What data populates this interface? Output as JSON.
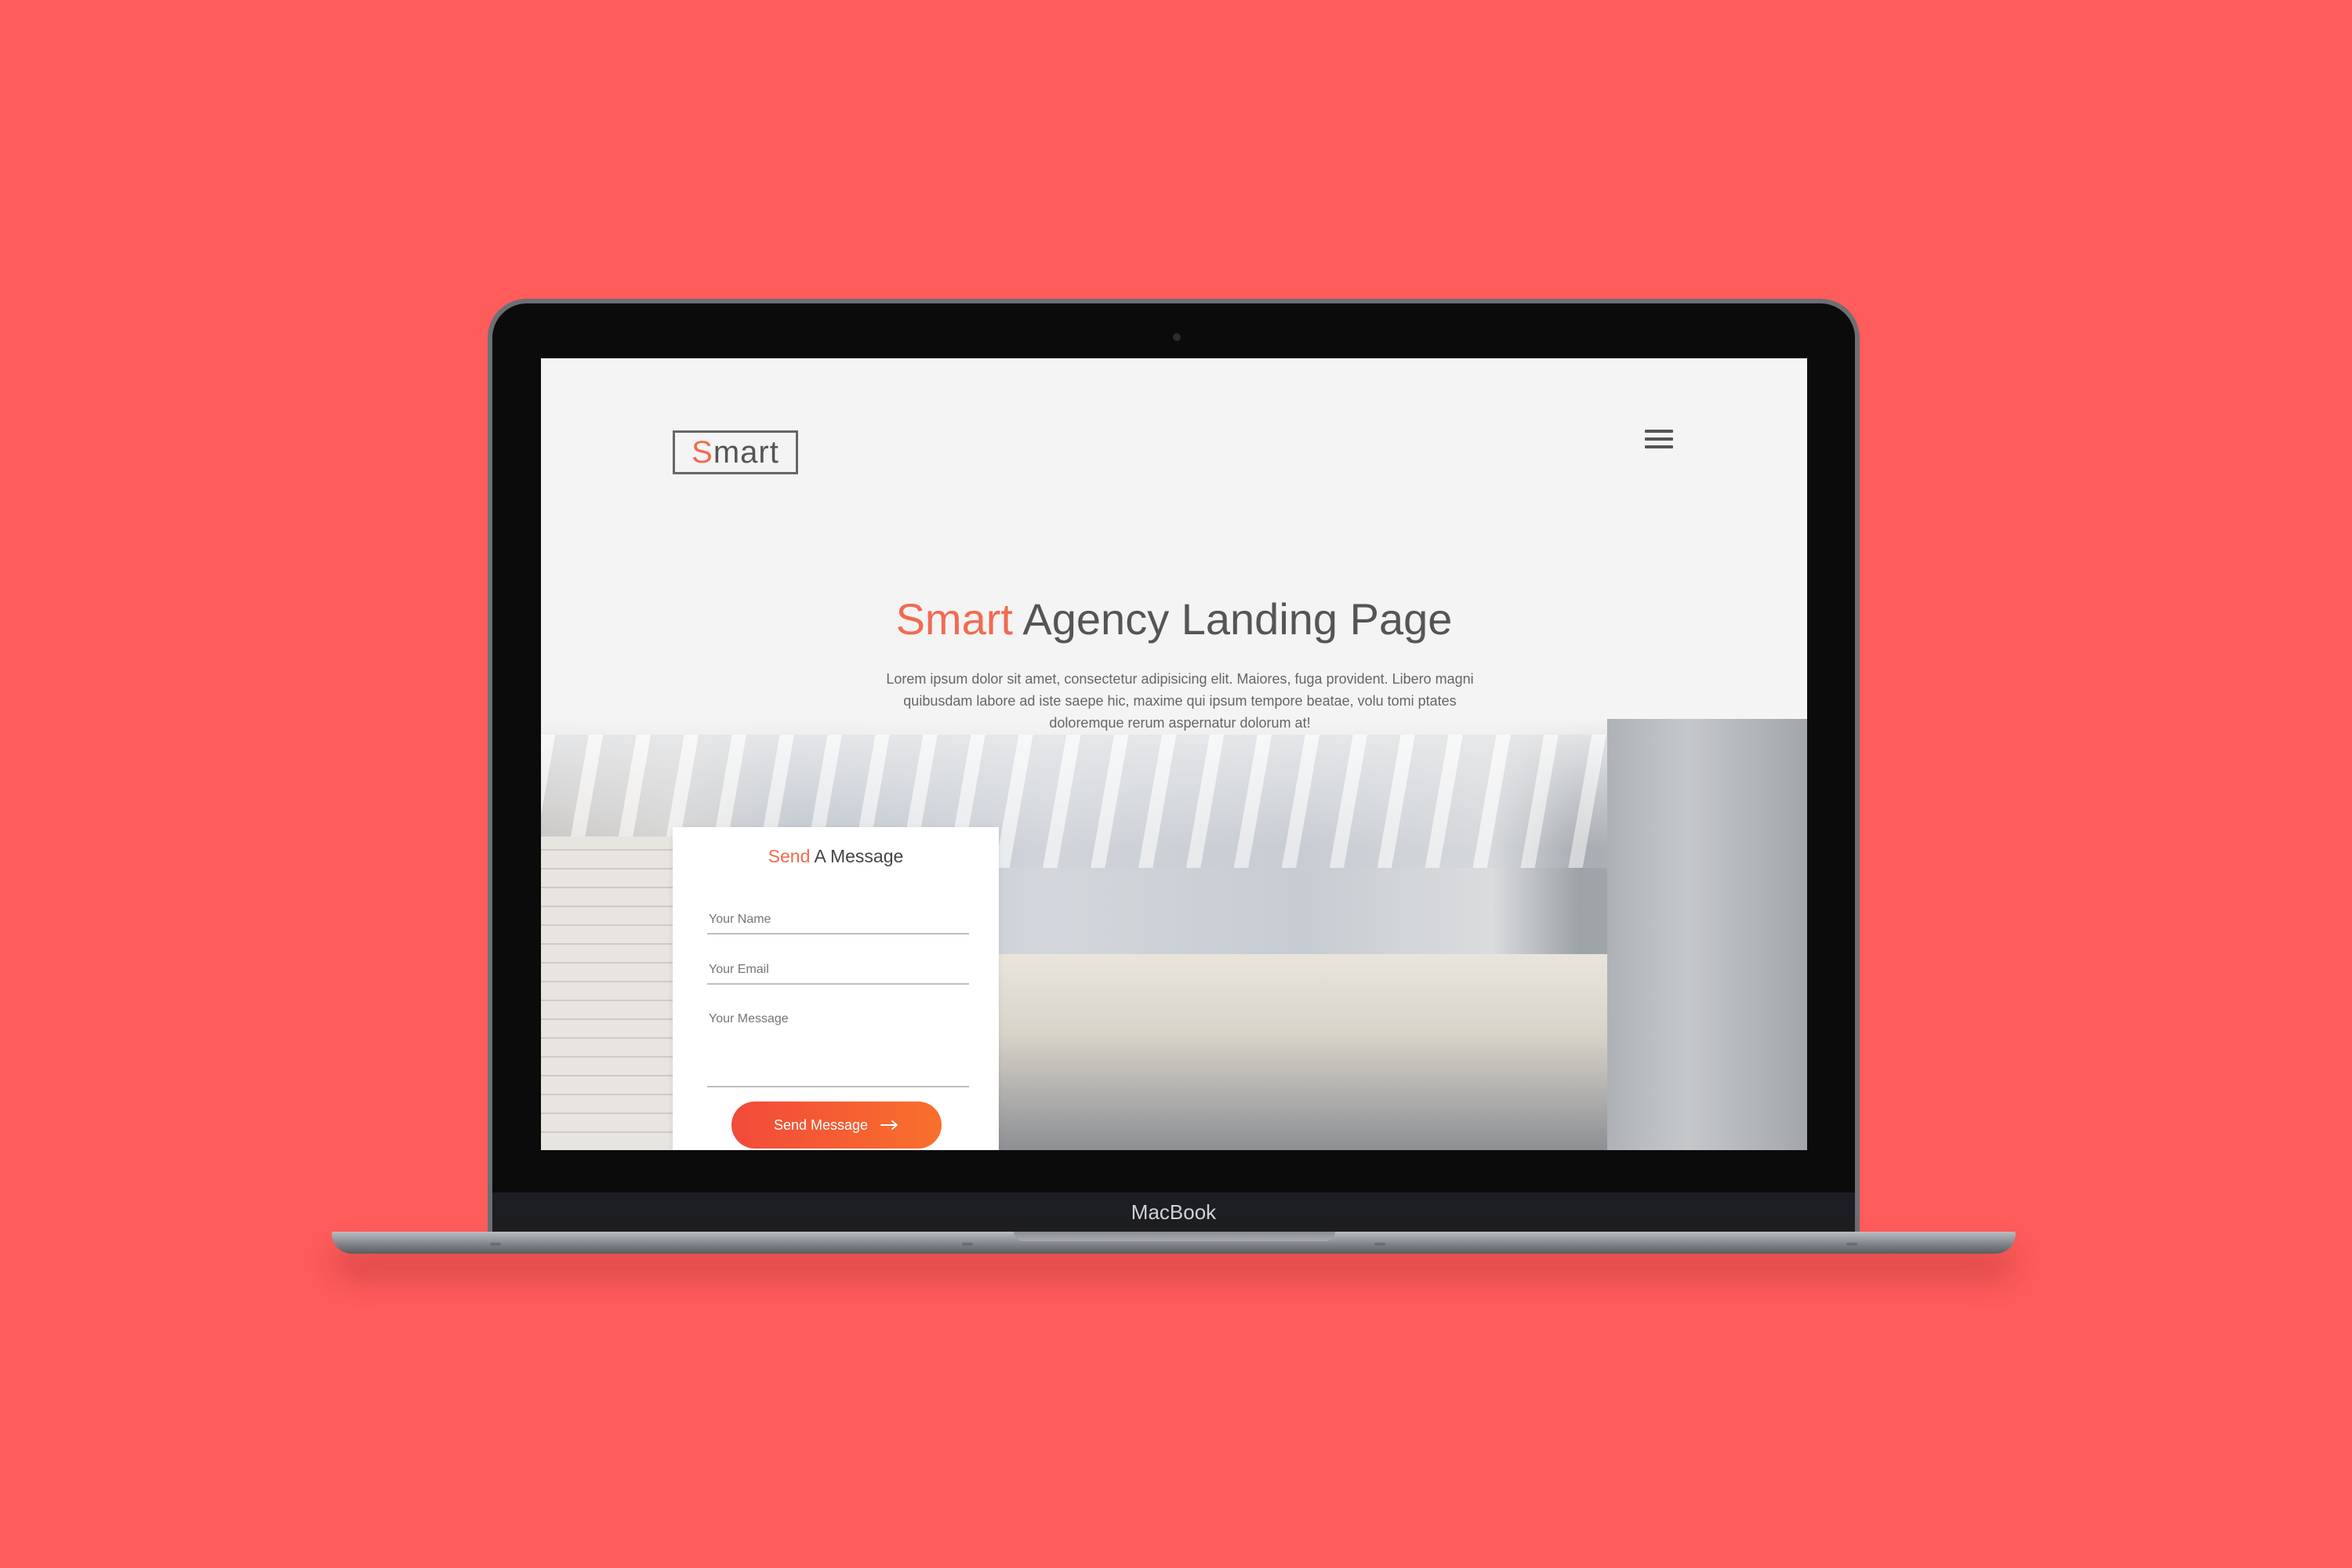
{
  "device": {
    "label": "MacBook"
  },
  "header": {
    "logo_accent": "S",
    "logo_rest": "mart",
    "menu_icon": "hamburger-menu-icon"
  },
  "hero": {
    "title_accent": "Smart",
    "title_rest": " Agency Landing Page",
    "description": "Lorem ipsum dolor sit amet, consectetur adipisicing elit. Maiores, fuga provident. Libero magni quibusdam labore ad iste saepe hic, maxime qui ipsum tempore beatae, volu tomi ptates doloremque rerum aspernatur dolorum at!"
  },
  "contact_form": {
    "title_accent": "Send",
    "title_rest": " A Message",
    "name_placeholder": "Your Name",
    "email_placeholder": "Your Email",
    "message_placeholder": "Your Message",
    "submit_label": "Send Message",
    "submit_icon": "arrow-right-icon"
  },
  "colors": {
    "background": "#ff5c5c",
    "accent": "#f26a4f",
    "button_gradient_start": "#f14a3a",
    "button_gradient_end": "#f9702c"
  }
}
